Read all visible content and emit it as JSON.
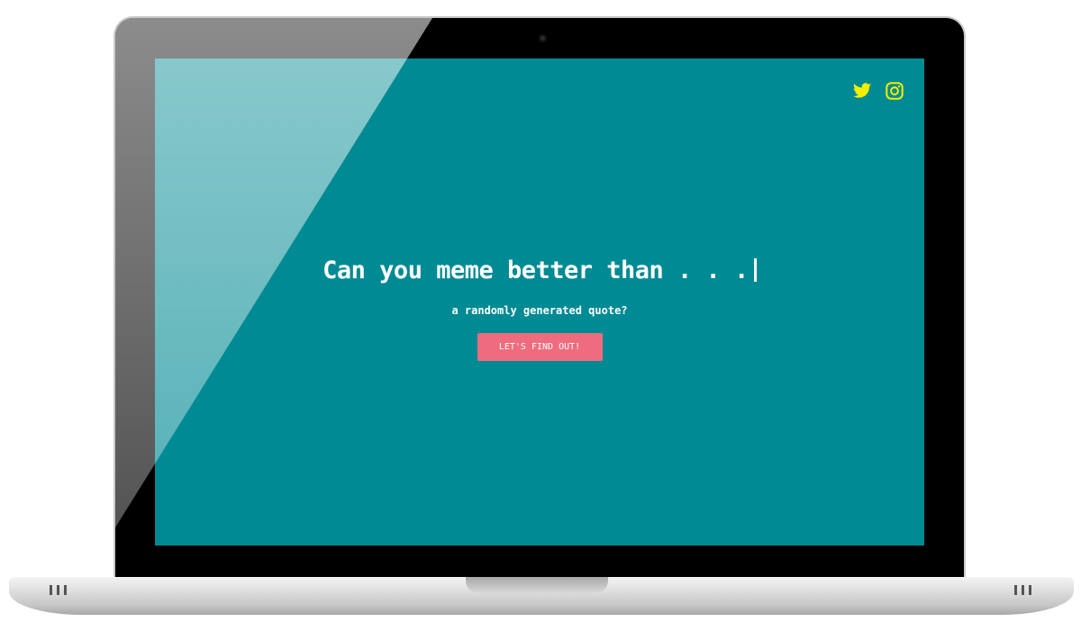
{
  "header": {
    "social": [
      {
        "name": "twitter-icon",
        "color": "#f2ee00"
      },
      {
        "name": "instagram-icon",
        "color": "#f2ee00"
      }
    ]
  },
  "hero": {
    "headline": "Can you meme better than . . .",
    "subtitle": "a randomly generated quote?",
    "cta_label": "LET'S FIND OUT!"
  },
  "colors": {
    "background": "#008a93",
    "accent_button": "#ee6c7e",
    "icon": "#f2ee00",
    "text": "#ffffff"
  }
}
